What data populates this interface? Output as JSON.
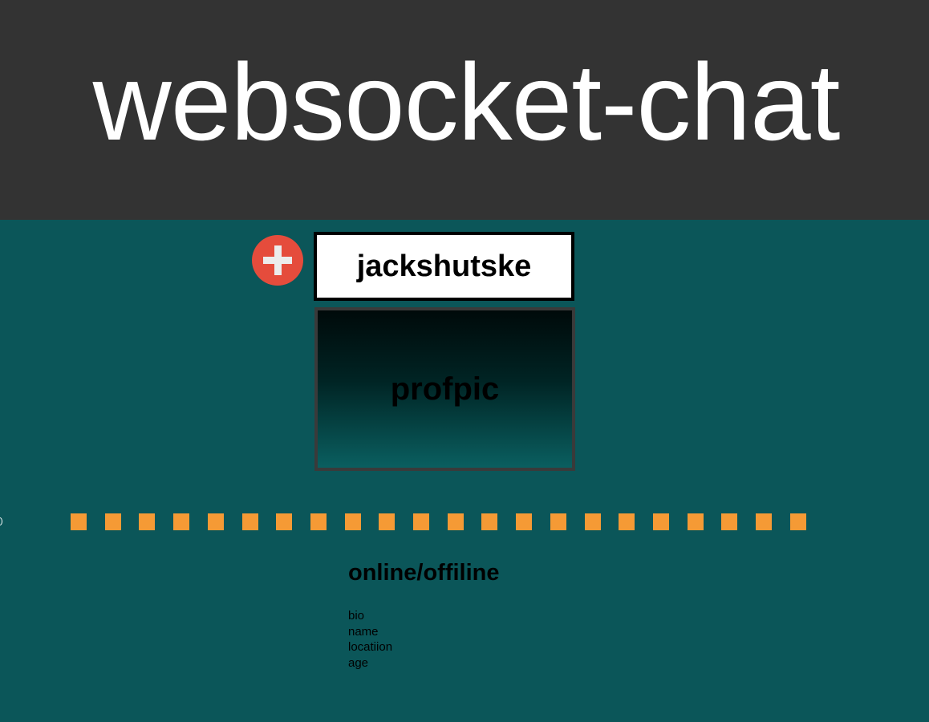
{
  "header": {
    "title": "websocket-chat"
  },
  "profile": {
    "add_button_icon": "plus-icon",
    "username": "jackshutske",
    "profile_picture_label": "profpic",
    "status": "online/offiline",
    "fields": [
      "bio",
      "name",
      "locatiion",
      "age"
    ]
  },
  "separator": {
    "dot_count": 22
  },
  "colors": {
    "header_bg": "#333333",
    "page_bg": "#0b5659",
    "add_button": "#e54c3c",
    "dots": "#f59a35"
  }
}
